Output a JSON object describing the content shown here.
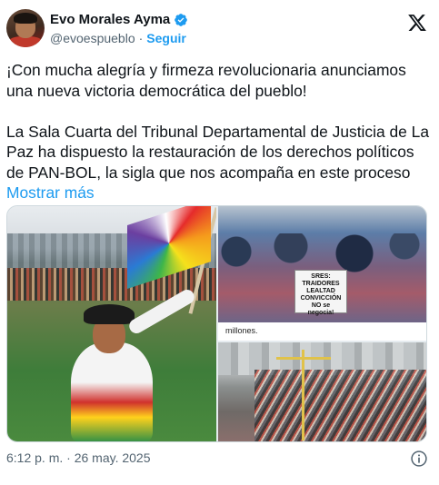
{
  "author": {
    "name": "Evo Morales Ayma",
    "handle": "@evoespueblo",
    "separator": "·",
    "follow_label": "Seguir"
  },
  "post": {
    "text": "¡Con mucha alegría y firmeza revolucionaria anunciamos una nueva victoria democrática del pueblo!\n\nLa Sala Cuarta del Tribunal Departamental de Justicia de La Paz ha dispuesto la restauración de los derechos políticos de PAN-BOL, la sigla que nos acompaña en este proceso ",
    "show_more": "Mostrar más",
    "timestamp": "6:12 p. m. · 26 may. 2025"
  },
  "media": {
    "sign_text": "SRES:\nTRAIDORES\nLEALTAD\nCONVICCIÓN\nNO se\nnegocia!",
    "caption_text": "millones."
  },
  "icons": {
    "verified": "verified-badge-icon",
    "x_logo": "x-logo-icon",
    "info": "info-icon"
  },
  "colors": {
    "accent": "#1d9bf0",
    "text": "#0f1419",
    "secondary": "#536471"
  }
}
